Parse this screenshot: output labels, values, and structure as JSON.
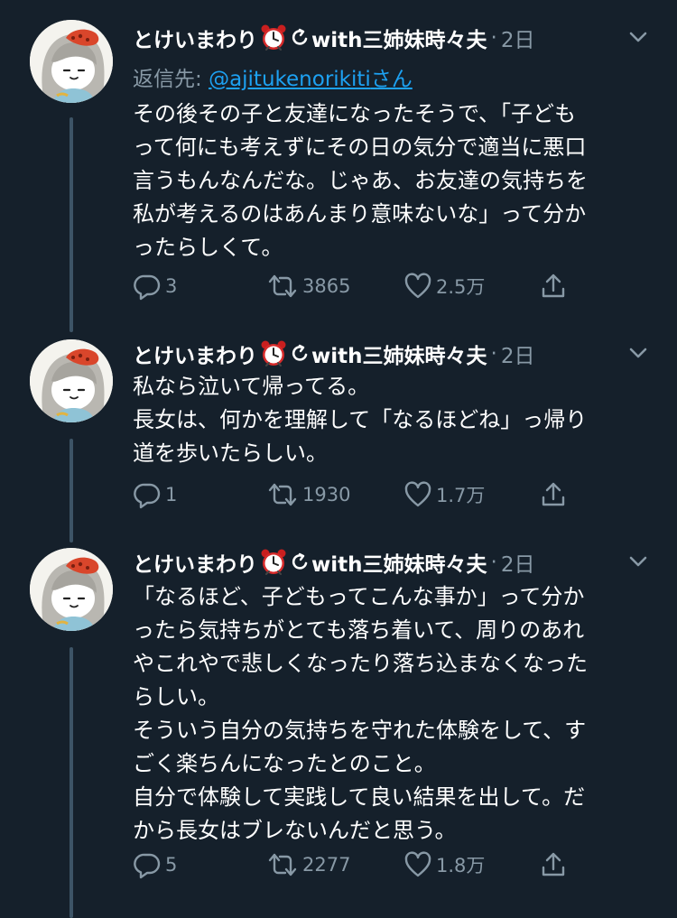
{
  "tweets": [
    {
      "author": "とけいまわり",
      "author_suffix": "with三姉妹時々夫",
      "time": "2日",
      "reply_prefix": "返信先: ",
      "reply_handle": "@ajitukenorikiti",
      "reply_suffix": "さん",
      "text": "その後その子と友達になったそうで、「子ども\nって何にも考えずにその日の気分で適当に悪口\n言うもんなんだな。じゃあ、お友達の気持ちを\n私が考えるのはあんまり意味ないな」って分か\nったらしくて。",
      "replies": "3",
      "retweets": "3865",
      "likes": "2.5万"
    },
    {
      "author": "とけいまわり",
      "author_suffix": "with三姉妹時々夫",
      "time": "2日",
      "text": "私なら泣いて帰ってる。\n長女は、何かを理解して「なるほどね」っ帰り\n道を歩いたらしい。",
      "replies": "1",
      "retweets": "1930",
      "likes": "1.7万"
    },
    {
      "author": "とけいまわり",
      "author_suffix": "with三姉妹時々夫",
      "time": "2日",
      "text": "「なるほど、子どもってこんな事か」って分か\nったら気持ちがとても落ち着いて、周りのあれ\nやこれやで悲しくなったり落ち込まなくなった\nらしい。\nそういう自分の気持ちを守れた体験をして、す\nごく楽ちんになったとのこと。\n自分で体験して実践して良い結果を出して。だ\nから長女はブレないんだと思う。",
      "replies": "5",
      "retweets": "2277",
      "likes": "1.8万"
    }
  ],
  "icons": {
    "clock": "alarm-clock-emoji",
    "verified_mark": "curved-arrow",
    "reply": "speech-bubble-icon",
    "retweet": "retweet-icon",
    "like": "heart-icon",
    "share": "share-upload-icon",
    "more": "chevron-down-icon"
  },
  "colors": {
    "background": "#15202b",
    "text": "#ffffff",
    "secondary": "#8899a6",
    "link": "#1da1f2",
    "thread_line": "#3d5466"
  }
}
